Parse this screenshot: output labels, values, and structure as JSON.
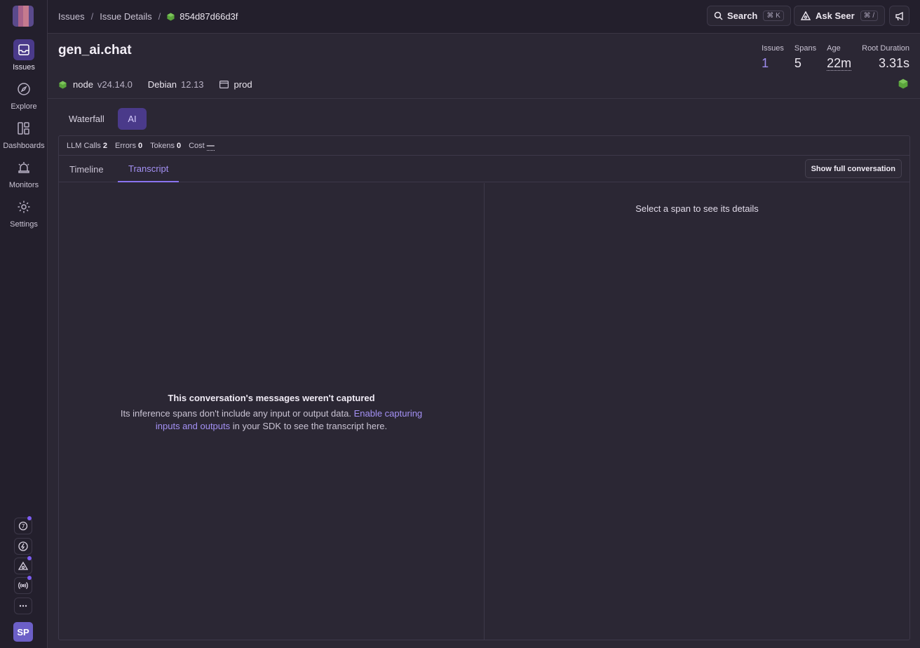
{
  "sidebar": {
    "items": [
      {
        "label": "Issues",
        "icon": "inbox-icon"
      },
      {
        "label": "Explore",
        "icon": "compass-icon"
      },
      {
        "label": "Dashboards",
        "icon": "dashboard-icon"
      },
      {
        "label": "Monitors",
        "icon": "siren-icon"
      },
      {
        "label": "Settings",
        "icon": "gear-icon"
      }
    ],
    "avatar": "SP"
  },
  "breadcrumb": {
    "items": [
      "Issues",
      "Issue Details"
    ],
    "current": "854d87d66d3f",
    "separator": "/"
  },
  "topbar": {
    "search_label": "Search",
    "search_kbd": "⌘ K",
    "seer_label": "Ask Seer",
    "seer_kbd": "⌘ /"
  },
  "trace": {
    "title": "gen_ai.chat",
    "tags": [
      {
        "name": "node",
        "value": "v24.14.0"
      },
      {
        "name": "Debian",
        "value": "12.13"
      },
      {
        "name": "prod",
        "value": ""
      }
    ],
    "stats": {
      "issues_label": "Issues",
      "issues_value": "1",
      "spans_label": "Spans",
      "spans_value": "5",
      "age_label": "Age",
      "age_value": "22m",
      "root_duration_label": "Root Duration",
      "root_duration_value": "3.31s"
    }
  },
  "view_tabs": {
    "waterfall": "Waterfall",
    "ai": "AI"
  },
  "metrics": {
    "llm_calls_label": "LLM Calls",
    "llm_calls_value": "2",
    "errors_label": "Errors",
    "errors_value": "0",
    "tokens_label": "Tokens",
    "tokens_value": "0",
    "cost_label": "Cost",
    "cost_value": "—"
  },
  "subtabs": {
    "timeline": "Timeline",
    "transcript": "Transcript",
    "show_full": "Show full conversation"
  },
  "empty_state": {
    "title": "This conversation's messages weren't captured",
    "desc_prefix": "Its inference spans don't include any input or output data. ",
    "link": "Enable capturing inputs and outputs",
    "desc_suffix": " in your SDK to see the transcript here."
  },
  "details": {
    "placeholder": "Select a span to see its details"
  },
  "colors": {
    "accent": "#8a73f0",
    "node_green": "#5aa43c",
    "background": "#2b2734",
    "sidebar": "#231f2c"
  }
}
